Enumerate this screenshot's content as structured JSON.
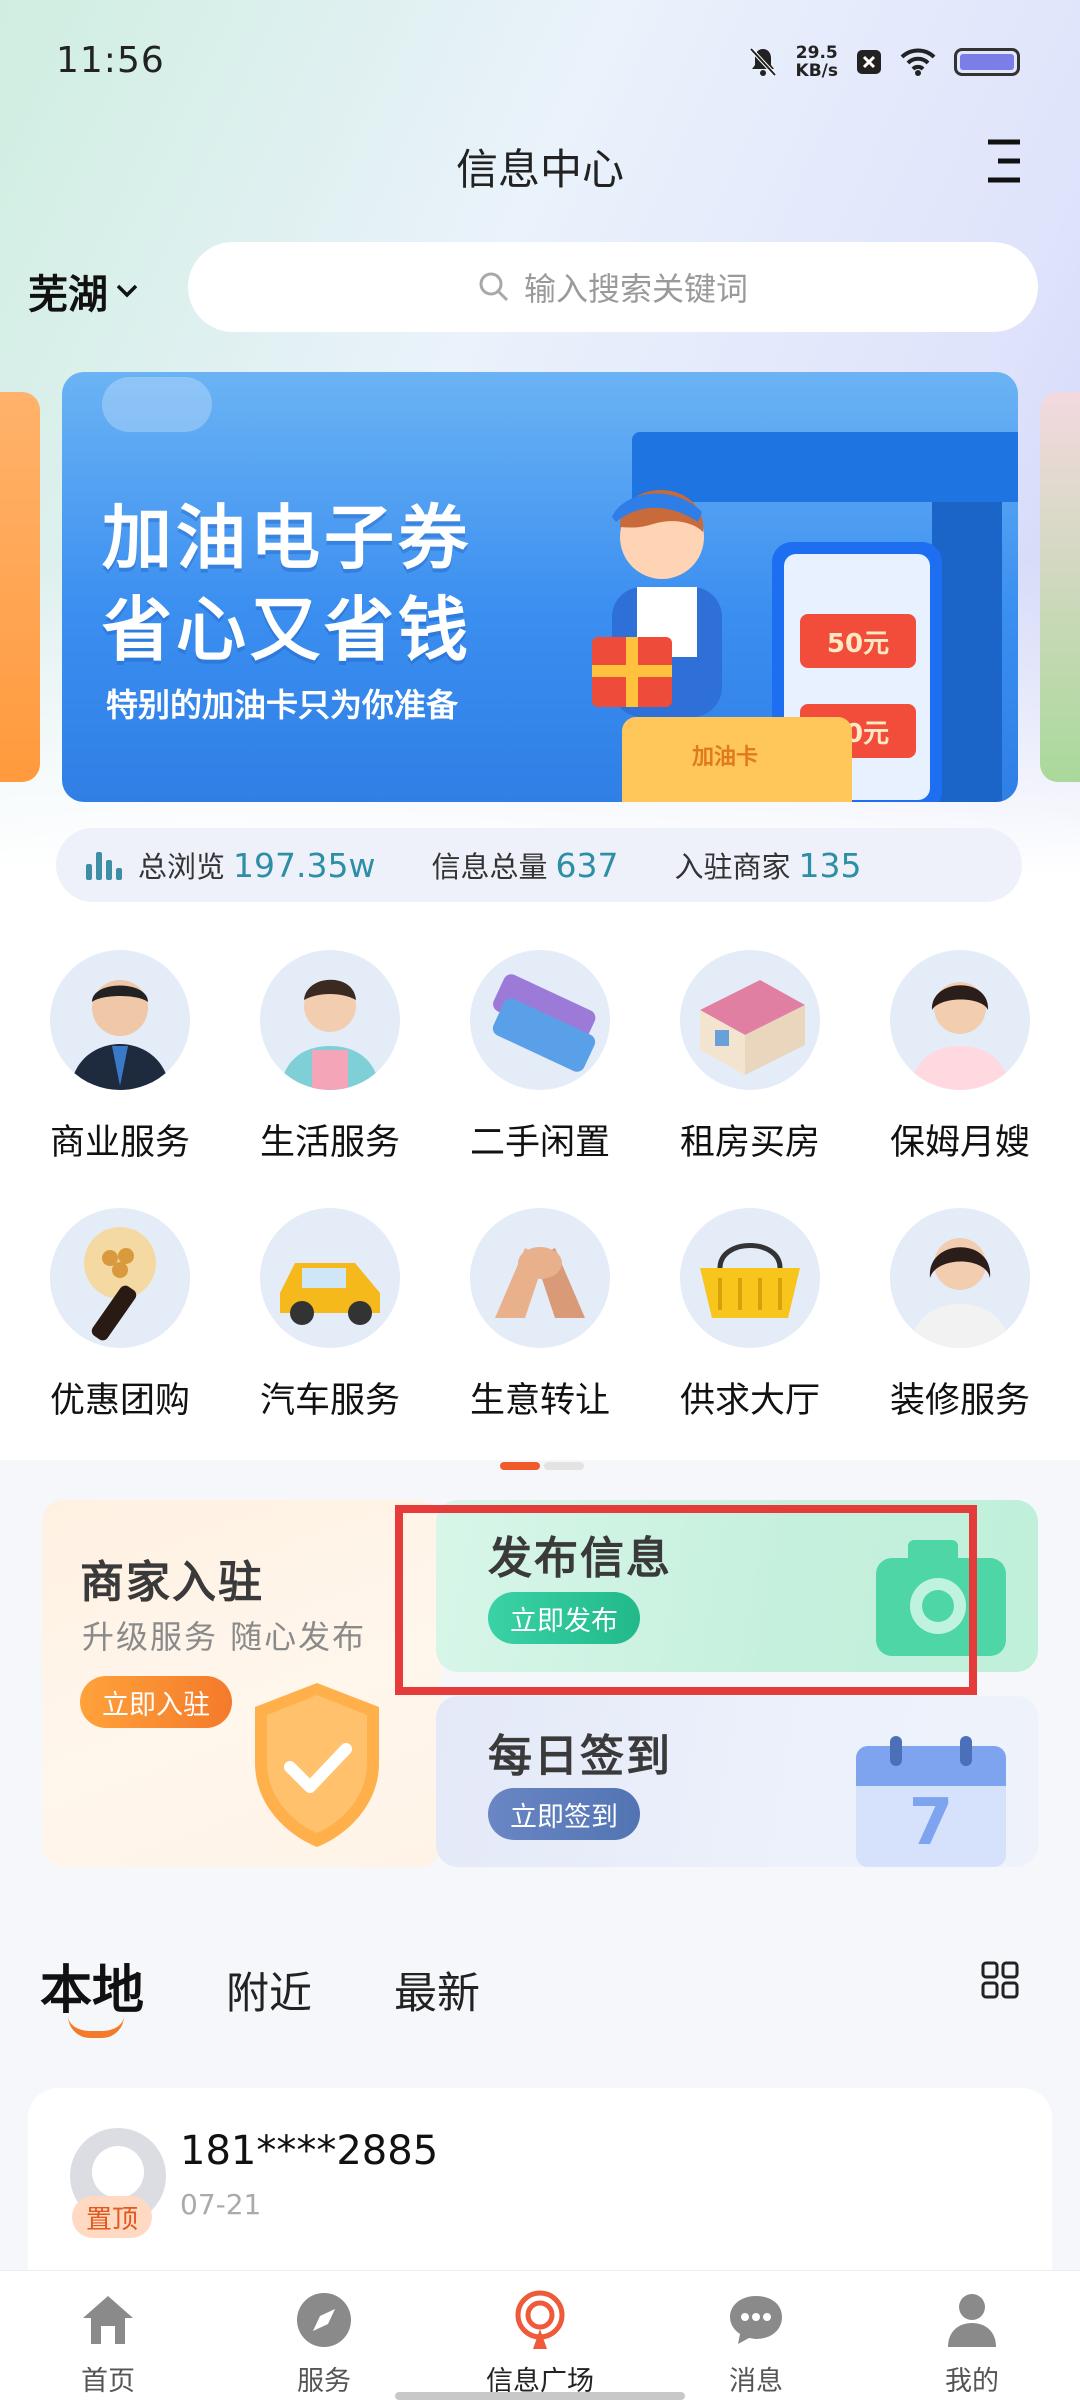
{
  "status_bar": {
    "time": "11:56",
    "net_speed_value": "29.5",
    "net_speed_unit": "KB/s",
    "icons": [
      "bell-off-icon",
      "close-box-icon",
      "wifi-icon",
      "battery-icon"
    ]
  },
  "header": {
    "title": "信息中心",
    "menu_icon": "menu-icon"
  },
  "location": {
    "city": "芜湖"
  },
  "search": {
    "placeholder": "输入搜索关键词"
  },
  "banner": {
    "headline_line1": "加油电子券",
    "headline_line2": "省心又省钱",
    "subtitle": "特别的加油卡只为你准备",
    "coupon_1": "50元",
    "coupon_2": "50元",
    "card_label": "加油卡"
  },
  "stats": [
    {
      "label": "总浏览",
      "value": "197.35w"
    },
    {
      "label": "信息总量",
      "value": "637"
    },
    {
      "label": "入驻商家",
      "value": "135"
    }
  ],
  "categories": [
    {
      "label": "商业服务"
    },
    {
      "label": "生活服务"
    },
    {
      "label": "二手闲置"
    },
    {
      "label": "租房买房"
    },
    {
      "label": "保姆月嫂"
    },
    {
      "label": "优惠团购"
    },
    {
      "label": "汽车服务"
    },
    {
      "label": "生意转让"
    },
    {
      "label": "供求大厅"
    },
    {
      "label": "装修服务"
    }
  ],
  "promo": {
    "merchant": {
      "title": "商家入驻",
      "subtitle": "升级服务 随心发布",
      "button": "立即入驻"
    },
    "publish": {
      "title": "发布信息",
      "button": "立即发布"
    },
    "sign_in": {
      "title": "每日签到",
      "button": "立即签到",
      "calendar_day": "7"
    }
  },
  "tabs": [
    {
      "label": "本地",
      "active": true
    },
    {
      "label": "附近",
      "active": false
    },
    {
      "label": "最新",
      "active": false
    }
  ],
  "post": {
    "phone": "181****2885",
    "date": "07-21",
    "badge": "置顶"
  },
  "bottom_nav": [
    {
      "label": "首页",
      "icon": "home-icon"
    },
    {
      "label": "服务",
      "icon": "compass-icon"
    },
    {
      "label": "信息广场",
      "icon": "broadcast-icon",
      "active": true
    },
    {
      "label": "消息",
      "icon": "chat-icon"
    },
    {
      "label": "我的",
      "icon": "user-icon"
    }
  ],
  "colors": {
    "accent_orange": "#f47a2b",
    "stat_value": "#2d8fa5",
    "highlight_red": "#e63b3b",
    "publish_green": "#2fc79a",
    "sign_blue": "#5a7ab8"
  }
}
